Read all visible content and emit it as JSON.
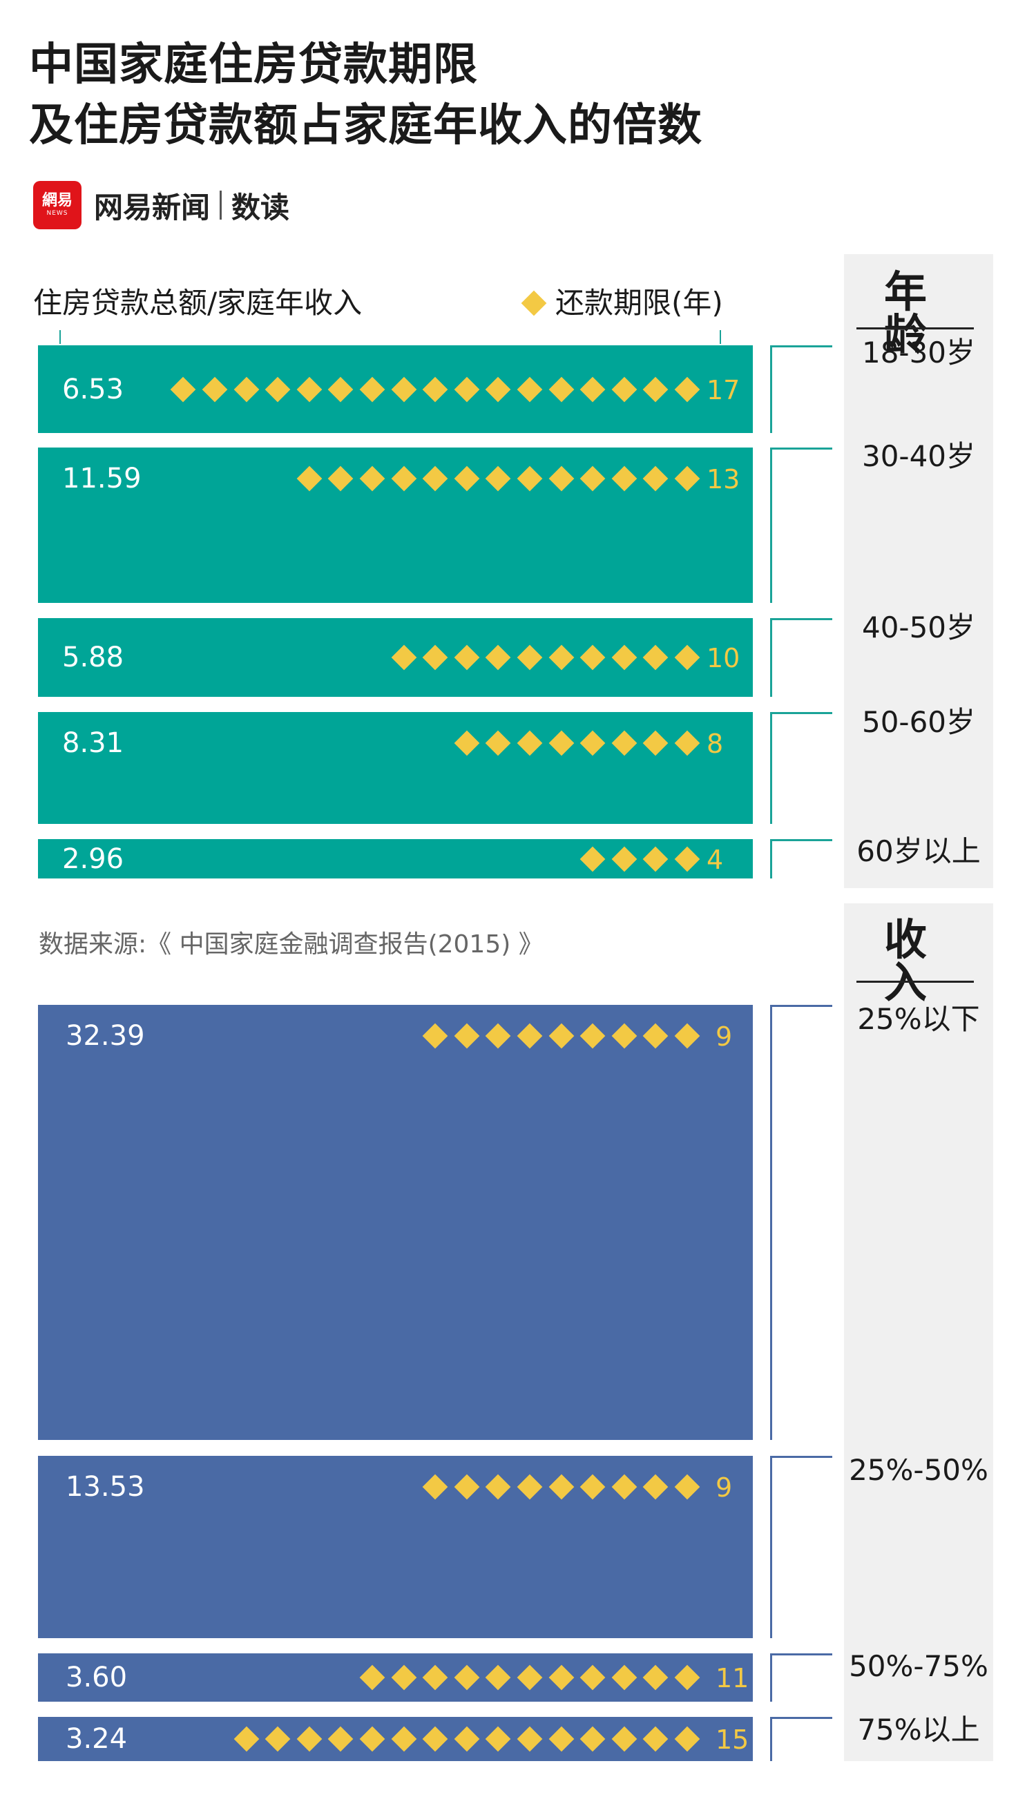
{
  "title_line1": "中国家庭住房贷款期限",
  "title_line2": "及住房贷款额占家庭年收入的倍数",
  "brand": {
    "logo_text": "網易",
    "logo_sub": "NEWS",
    "name": "网易新闻",
    "sub": "数读"
  },
  "colors": {
    "age_bar": "#00a597",
    "income_bar": "#4a6aa5",
    "diamond": "#f3c944",
    "panel": "#f0f0f0"
  },
  "chart_data": {
    "type": "bar",
    "xlabel": "住房贷款总额/家庭年收入",
    "legend": "还款期限(年)",
    "legend_icon": "diamond-icon",
    "source": "数据来源:《 中国家庭金融调查报告(2015) 》",
    "groups": [
      {
        "name": "年 龄",
        "categories": [
          "18-30岁",
          "30-40岁",
          "40-50岁",
          "50-60岁",
          "60岁以上"
        ],
        "ratio": [
          "6.53",
          "11.59",
          "5.88",
          "8.31",
          "2.96"
        ],
        "years": [
          "17",
          "13",
          "10",
          "8",
          "4"
        ]
      },
      {
        "name": "收 入",
        "categories": [
          "25%以下",
          "25%-50%",
          "50%-75%",
          "75%以上"
        ],
        "ratio": [
          "32.39",
          "13.53",
          "3.60",
          "3.24"
        ],
        "years": [
          "9",
          "9",
          "11",
          "15"
        ]
      }
    ]
  }
}
